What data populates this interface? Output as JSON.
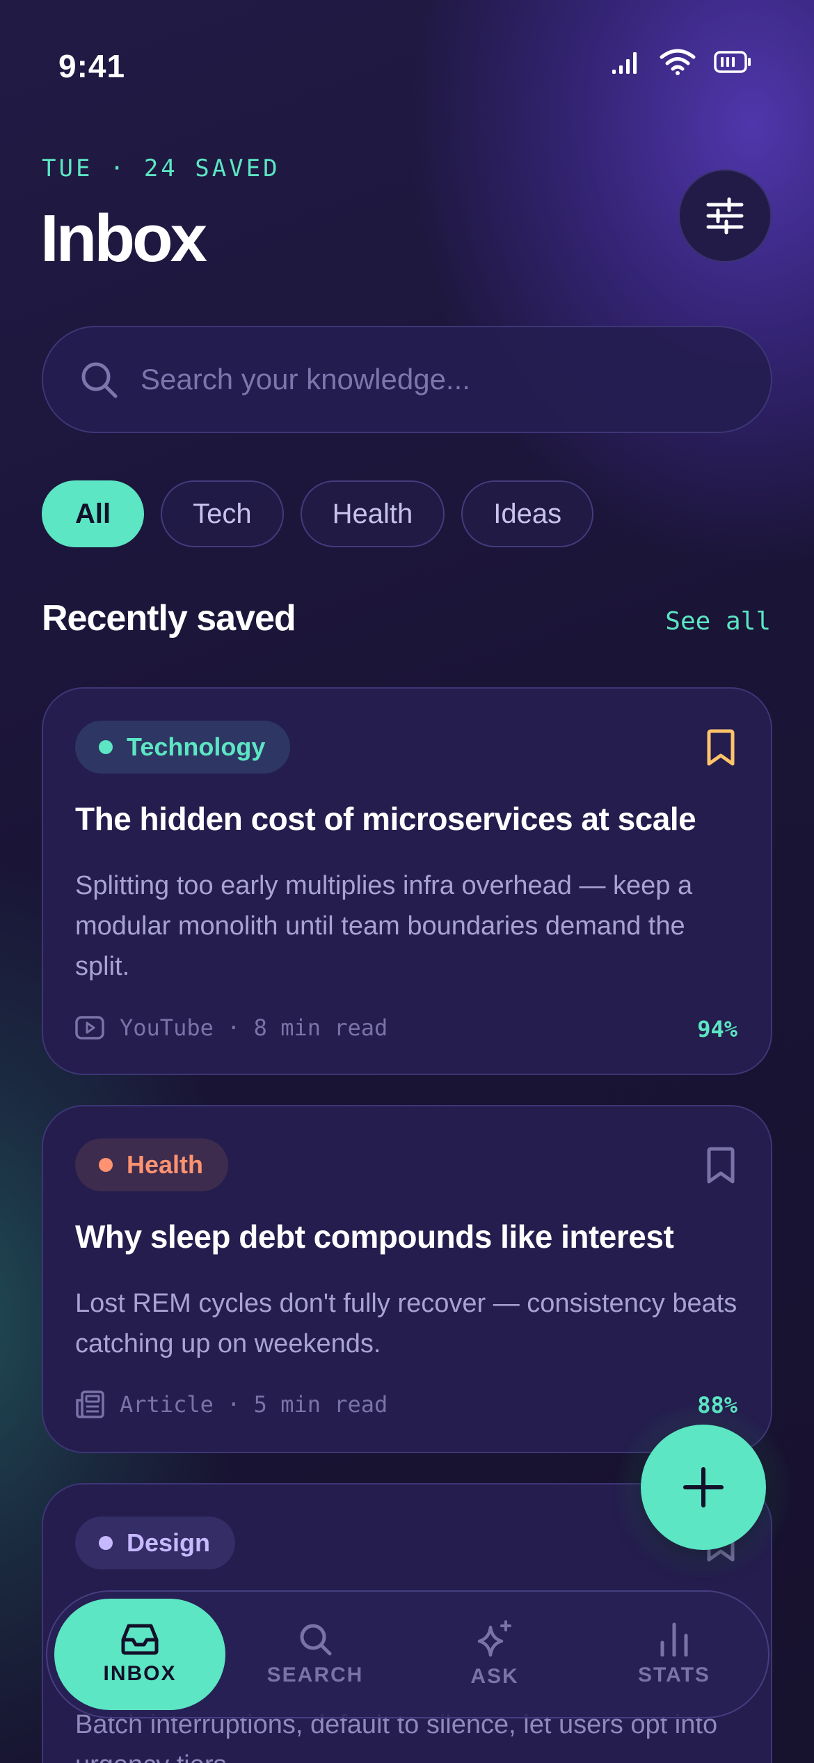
{
  "status_bar": {
    "time": "9:41"
  },
  "header": {
    "eyebrow": "TUE · 24 SAVED",
    "title": "Inbox",
    "filter_icon": "sliders-icon"
  },
  "search": {
    "placeholder": "Search your knowledge...",
    "value": ""
  },
  "filters": {
    "items": [
      {
        "label": "All",
        "active": true
      },
      {
        "label": "Tech",
        "active": false
      },
      {
        "label": "Health",
        "active": false
      },
      {
        "label": "Ideas",
        "active": false
      }
    ]
  },
  "section": {
    "title": "Recently saved",
    "see_all": "See all"
  },
  "cards": [
    {
      "tag": "Technology",
      "tag_color": "#5ce6c3",
      "bookmarked": true,
      "title": "The hidden cost of microservices at scale",
      "description": "Splitting too early multiplies infra overhead — keep a modular monolith until team boundaries demand the split.",
      "source_icon": "play-icon",
      "meta": "YouTube · 8 min read",
      "score": "94%"
    },
    {
      "tag": "Health",
      "tag_color": "#ff9270",
      "bookmarked": false,
      "title": "Why sleep debt compounds like interest",
      "description": "Lost REM cycles don't fully recover — consistency beats catching up on weekends.",
      "source_icon": "newspaper-icon",
      "meta": "Article · 5 min read",
      "score": "88%"
    },
    {
      "tag": "Design",
      "tag_color": "#c7b9ff",
      "bookmarked": false,
      "description": "Batch interruptions, default to silence, let users opt into urgency tiers."
    }
  ],
  "fab": {
    "icon": "plus-icon"
  },
  "tabbar": {
    "items": [
      {
        "label": "INBOX",
        "icon": "inbox-icon",
        "active": true
      },
      {
        "label": "SEARCH",
        "icon": "search-icon",
        "active": false
      },
      {
        "label": "ASK",
        "icon": "sparkle-icon",
        "active": false
      },
      {
        "label": "STATS",
        "icon": "bar-chart-icon",
        "active": false
      }
    ]
  },
  "colors": {
    "accent": "#5ce6c3",
    "background": "#17122e",
    "card": "#241d4d",
    "bookmark_active": "#ffc46b"
  }
}
